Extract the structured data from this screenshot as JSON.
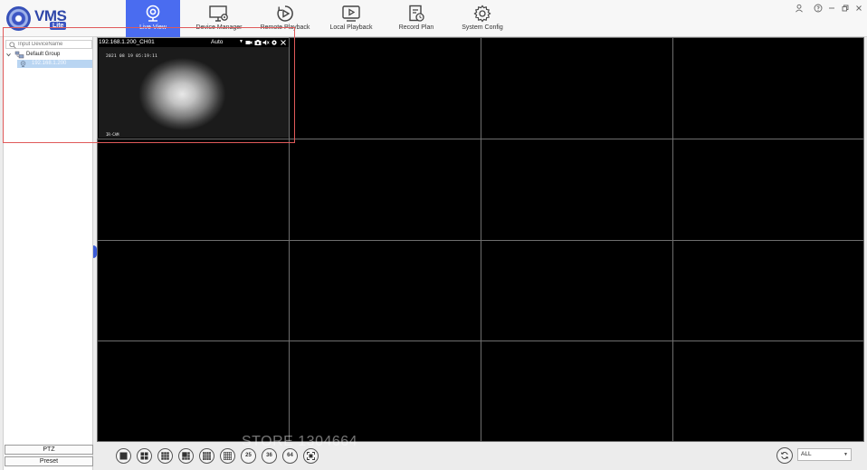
{
  "app": {
    "logo_text": "VMS",
    "logo_sub": "Lite"
  },
  "nav": [
    {
      "label": "Live View",
      "icon": "webcam-icon",
      "active": true
    },
    {
      "label": "Device Manager",
      "icon": "monitor-gear-icon"
    },
    {
      "label": "Remote Playback",
      "icon": "circle-play-icon"
    },
    {
      "label": "Local Playback",
      "icon": "screen-play-icon"
    },
    {
      "label": "Record Plan",
      "icon": "document-clock-icon"
    },
    {
      "label": "System Config",
      "icon": "gear-icon"
    }
  ],
  "window_controls": [
    "user-icon",
    "help-icon",
    "minimize-icon",
    "restore-icon",
    "close-icon"
  ],
  "sidebar": {
    "search_placeholder": "Input DeviceName",
    "group": "Default Group",
    "device": "192.168.1.200",
    "ptz_label": "PTZ",
    "preset_label": "Preset"
  },
  "live": {
    "camera_name": "192.168.1.200_CH01",
    "stream_mode": "Auto",
    "osd_time": "2021 08 19 05:19:11",
    "osd_cam": "IR-CAM"
  },
  "toolbar": {
    "layouts": [
      "1",
      "4",
      "9",
      "6",
      "16",
      "16-alt",
      "25",
      "36",
      "64",
      "fullscreen"
    ],
    "layout_numbers": {
      "n25": "25",
      "n36": "36",
      "n64": "64"
    },
    "watermark": "STORE 1304664",
    "stream_select": "ALL"
  },
  "colors": {
    "accent": "#4a6cf0",
    "selection": "#b9d5f2",
    "highlight": "#e05a5a"
  }
}
